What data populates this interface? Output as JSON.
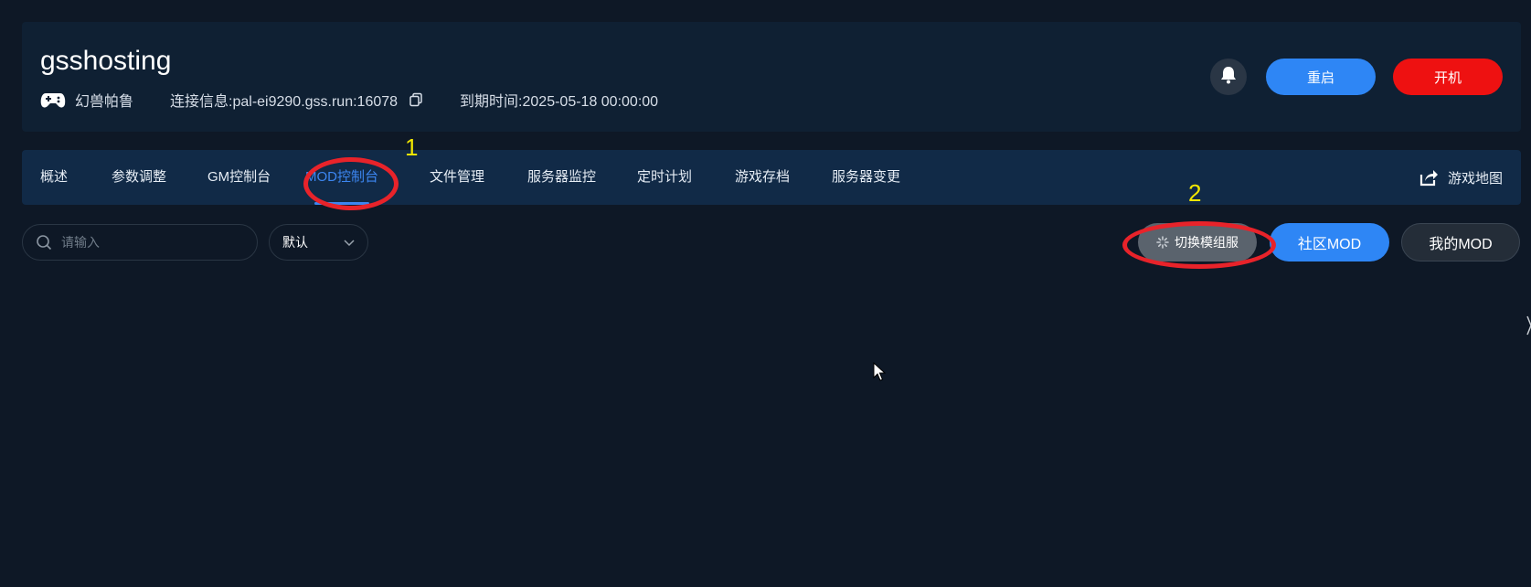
{
  "header": {
    "server_name": "gsshosting",
    "game_name": "幻兽帕鲁",
    "connection_label": "连接信息:pal-ei9290.gss.run:16078",
    "expiry_label": "到期时间:2025-05-18 00:00:00",
    "restart_label": "重启",
    "start_label": "开机",
    "icons": [
      "gamepad-icon",
      "copy-icon",
      "bell-icon"
    ]
  },
  "tabs": [
    {
      "label": "概述"
    },
    {
      "label": "参数调整"
    },
    {
      "label": "GM控制台"
    },
    {
      "label": "MOD控制台",
      "active": true
    },
    {
      "label": "文件管理"
    },
    {
      "label": "服务器监控"
    },
    {
      "label": "定时计划"
    },
    {
      "label": "游戏存档"
    },
    {
      "label": "服务器变更"
    }
  ],
  "map_link": {
    "label": "游戏地图",
    "icon": "share-icon"
  },
  "toolbar": {
    "search_placeholder": "请输入",
    "select_value": "默认",
    "switch_label": "切换模组服",
    "community_label": "社区MOD",
    "mymod_label": "我的MOD"
  },
  "annotations": {
    "marker_1": "1",
    "marker_2": "2",
    "ring_color": "#e8232a",
    "number_color": "#f2e600"
  },
  "colors": {
    "accent": "#2e86f5",
    "danger": "#ee1111",
    "background": "#0e1826"
  }
}
